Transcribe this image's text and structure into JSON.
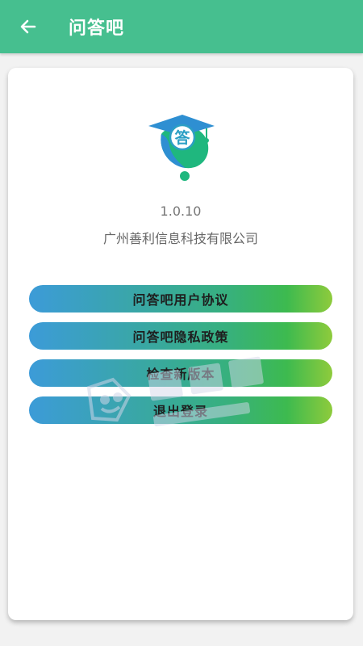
{
  "header": {
    "title": "问答吧",
    "back_icon": "arrow-left-icon"
  },
  "about": {
    "logo_glyph": "答",
    "logo_icon": "graduation-cap-question-logo",
    "version": "1.0.10",
    "company": "广州善利信息科技有限公司"
  },
  "actions": [
    {
      "label": "问答吧用户协议"
    },
    {
      "label": "问答吧隐私政策"
    },
    {
      "label": "检查新版本"
    },
    {
      "label": "退出登录"
    }
  ],
  "colors": {
    "header": "#46bf8f",
    "pill_start": "#3c9bd8",
    "pill_end": "#8ecb3c"
  }
}
